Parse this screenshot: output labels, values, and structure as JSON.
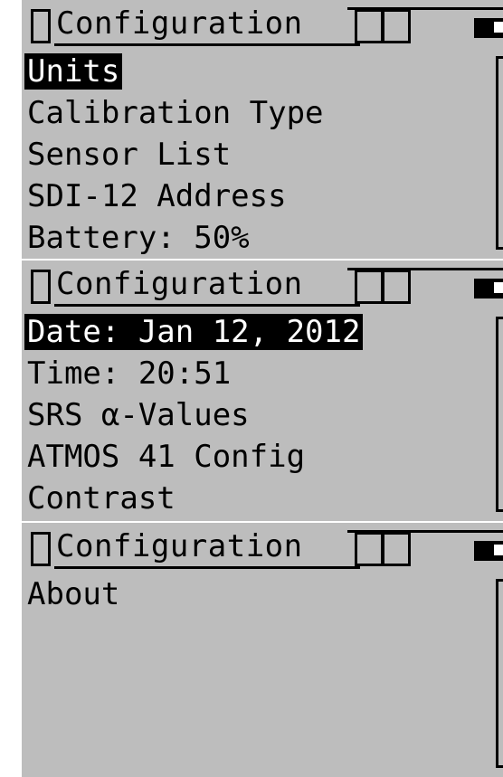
{
  "screens": [
    {
      "title": "Configuration",
      "items": [
        {
          "label": "Units",
          "selected": true
        },
        {
          "label": "Calibration Type",
          "selected": false
        },
        {
          "label": "Sensor List",
          "selected": false
        },
        {
          "label": "SDI-12 Address",
          "selected": false
        },
        {
          "label": "Battery: 50%",
          "selected": false
        }
      ]
    },
    {
      "title": "Configuration",
      "items": [
        {
          "label": "Date: Jan 12, 2012",
          "selected": true
        },
        {
          "label": "Time: 20:51",
          "selected": false
        },
        {
          "label": "SRS α-Values",
          "selected": false
        },
        {
          "label": "ATMOS 41 Config",
          "selected": false
        },
        {
          "label": "Contrast",
          "selected": false
        }
      ]
    },
    {
      "title": "Configuration",
      "items": [
        {
          "label": "About",
          "selected": false
        }
      ]
    }
  ],
  "colors": {
    "screen_bg": "#bdbdbd",
    "text": "#000000",
    "highlight_bg": "#000000",
    "highlight_text": "#ffffff"
  },
  "icons": [
    "tab-icon",
    "box-icon",
    "battery-icon",
    "scrollbar"
  ]
}
